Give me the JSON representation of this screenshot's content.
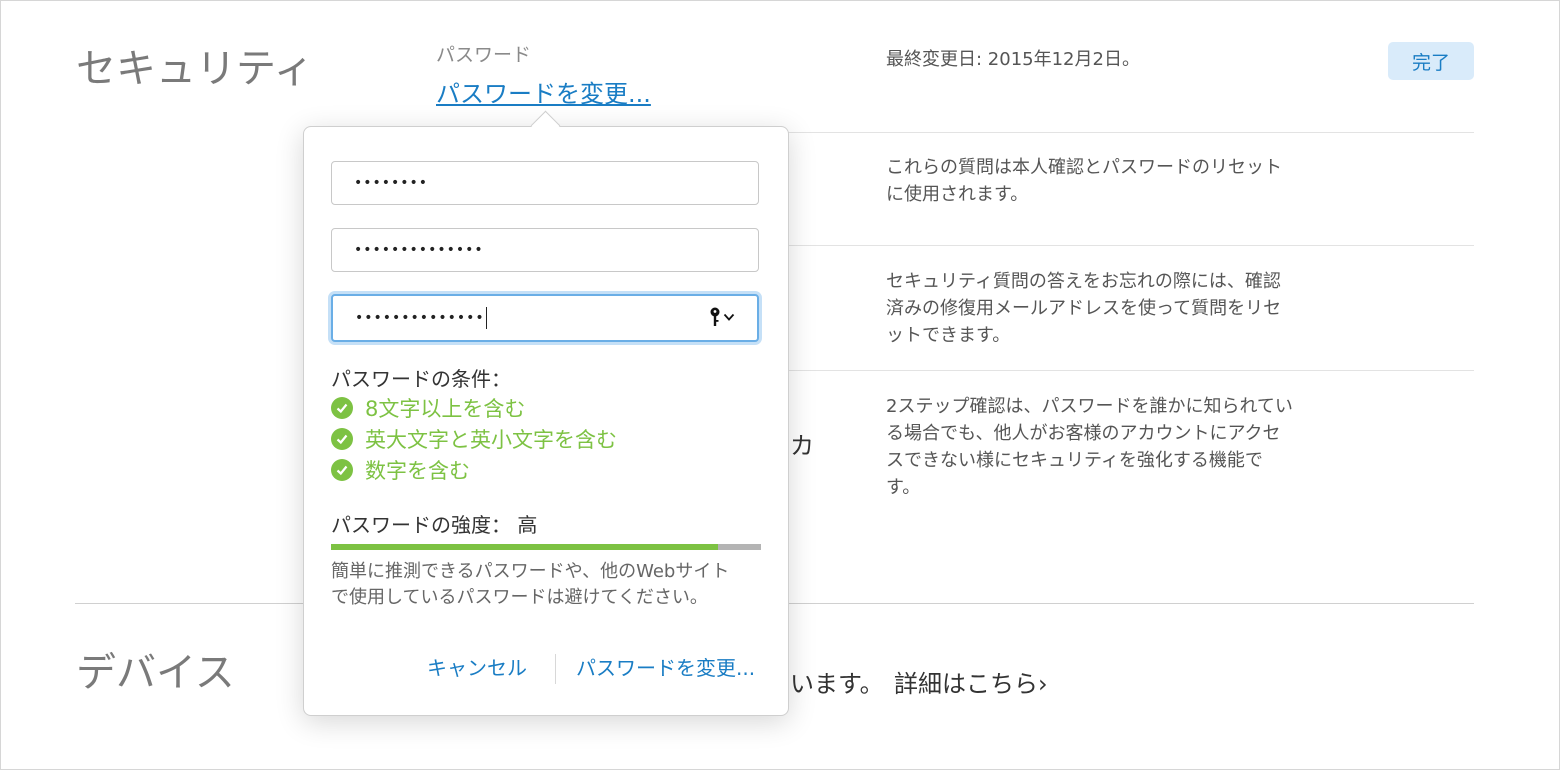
{
  "security": {
    "title": "セキュリティ",
    "password_label": "パスワード",
    "change_password_link": "パスワードを変更...",
    "last_changed": "最終変更日: 2015年12月2日。",
    "done_button": "完了"
  },
  "descriptions": {
    "questions": "これらの質問は本人確認とパスワードのリセットに使用されます。",
    "rescue_email": "セキュリティ質問の答えをお忘れの際には、確認済みの修復用メールアドレスを使って質問をリセットできます。",
    "two_step": "2ステップ確認は、パスワードを誰かに知られている場合でも、他人がお客様のアカウントにアクセスできない様にセキュリティを強化する機能です。",
    "two_step_partial": "カ"
  },
  "devices": {
    "title": "デバイス",
    "partial_text": "います。",
    "details_link": "詳細はこちら›"
  },
  "popover": {
    "current_password": "••••••••",
    "new_password": "••••••••••••••",
    "confirm_password": "••••••••••••••",
    "requirements_title": "パスワードの条件：",
    "requirements": [
      "8文字以上を含む",
      "英大文字と英小文字を含む",
      "数字を含む"
    ],
    "strength_label": "パスワードの強度：  高",
    "strength_fraction": 0.9,
    "hint": "簡単に推測できるパスワードや、他のWebサイトで使用しているパスワードは避けてください。",
    "cancel": "キャンセル",
    "change": "パスワードを変更..."
  },
  "colors": {
    "link": "#1a7dc4",
    "success": "#7dc243",
    "done_bg": "#d9ebfa"
  }
}
